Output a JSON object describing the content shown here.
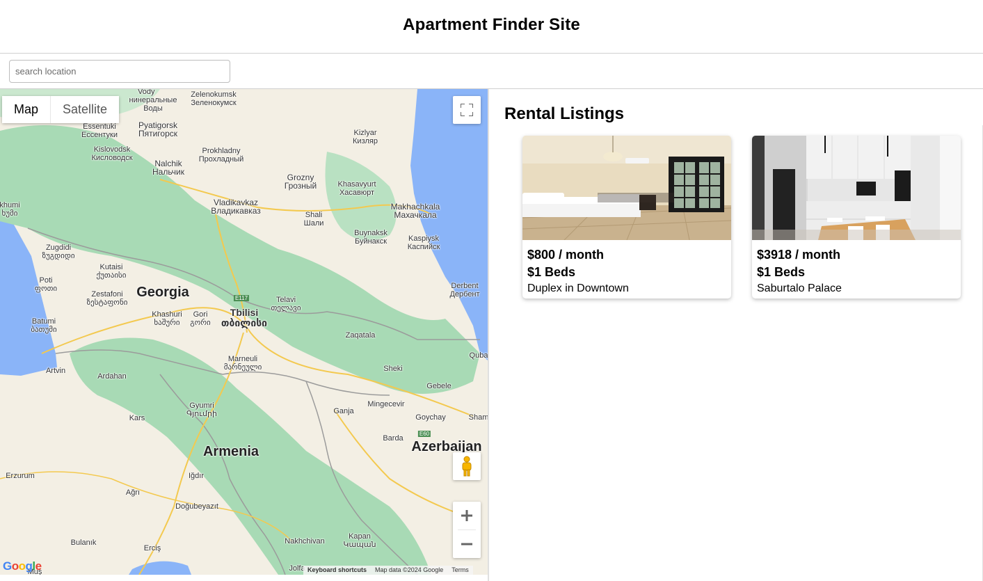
{
  "header": {
    "title": "Apartment Finder Site"
  },
  "search": {
    "placeholder": "search location",
    "value": ""
  },
  "map": {
    "map_type_active": "Map",
    "map_type_other": "Satellite",
    "labels": {
      "vody": "Vody",
      "vody_ru": "нинеральные Воды",
      "zelenokumsk": "Zelenokumsk\nЗеленокумск",
      "essentuki": "Essentuki\nЕссентуки",
      "pyatigorsk": "Pyatigorsk\nПятигорск",
      "kizlyar": "Kizlyar\nКизляр",
      "kislovodsk": "Kislovodsk\nКисловодск",
      "prokhladny": "Prokhladny\nПрохладный",
      "nalchik": "Nalchik\nНальчик",
      "grozny": "Grozny\nГрозный",
      "khasavyurt": "Khasavyurt\nХасавюрт",
      "vladikavkaz": "Vladikavkaz\nВладикавказ",
      "makhachkala": "Makhachkala\nМахачкала",
      "khumi": "khumi\nხუმი",
      "shali": "Shali\nШали",
      "buynaksk": "Buynaksk\nБуйнакск",
      "kaspiysk": "Kaspiysk\nКаспийск",
      "zugdidi": "Zugdidi\nზუგდიდი",
      "kutaisi": "Kutaisi\nქუთაისი",
      "derbent": "Derbent\nДербент",
      "poti": "Poti\nფოთი",
      "zestafoni": "Zestafoni\nზესტაფონი",
      "georgia": "Georgia",
      "telavi": "Telavi\nთელავი",
      "batumi": "Batumi\nბათუმი",
      "khashuri": "Khashuri\nხაშური",
      "gori": "Gori\nგორი",
      "tbilisi": "Tbilisi\nთბილისი",
      "zaqatala": "Zaqatala",
      "quba": "Quba",
      "marneuli": "Marneuli\nმარნეული",
      "artvin": "Artvin",
      "ardahan": "Ardahan",
      "sheki": "Sheki",
      "gebele": "Gebele",
      "gyumri": "Gyumri\nԳյումրի",
      "mingecevir": "Mingecevir",
      "kars": "Kars",
      "ganja": "Ganja",
      "goychay": "Goychay",
      "sham": "Sham",
      "barda": "Barda",
      "azerbaijan": "Azerbaijan",
      "armenia": "Armenia",
      "erzurum": "Erzurum",
      "igdir": "Iğdır",
      "agri": "Ağrı",
      "dogubeyazit": "Doğubeyazıt",
      "nakhchivan": "Nakhchivan",
      "kapan": "Kapan\nԿապան",
      "bulanik": "Bulanık",
      "ercis": "Erciş",
      "mus": "Muş",
      "jolfa": "Jolfa",
      "e117": "E117",
      "e60": "E60"
    },
    "google_logo": "Google",
    "attribution": {
      "shortcuts": "Keyboard shortcuts",
      "data": "Map data ©2024 Google",
      "terms": "Terms"
    },
    "colors": {
      "water": "#8ab4f8",
      "land": "#f5f0e4",
      "forest": "#a8dab5",
      "road": "#f9d36a"
    }
  },
  "listings": {
    "heading": "Rental Listings",
    "items": [
      {
        "price": "$800 / month",
        "beds": "$1 Beds",
        "name": "Duplex in Downtown"
      },
      {
        "price": "$3918 / month",
        "beds": "$1 Beds",
        "name": "Saburtalo Palace"
      }
    ]
  }
}
